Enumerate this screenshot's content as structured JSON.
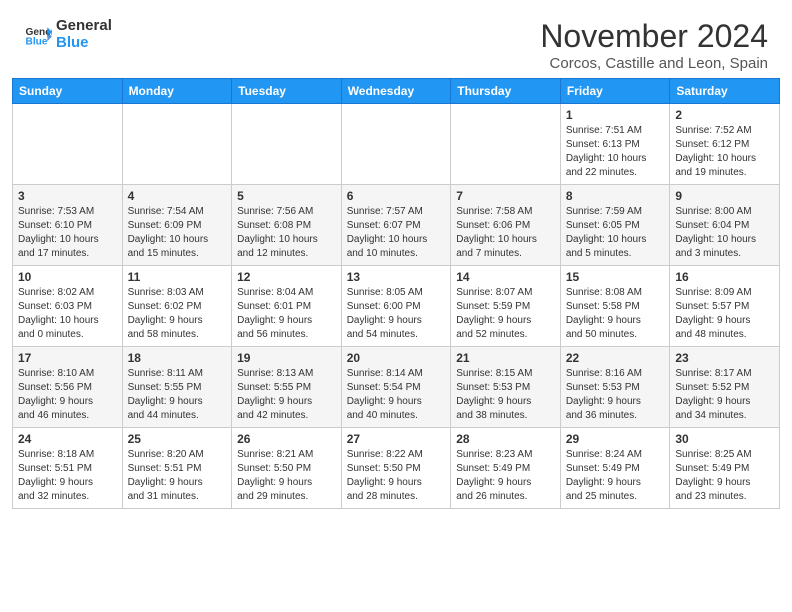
{
  "header": {
    "logo_line1": "General",
    "logo_line2": "Blue",
    "month": "November 2024",
    "location": "Corcos, Castille and Leon, Spain"
  },
  "weekdays": [
    "Sunday",
    "Monday",
    "Tuesday",
    "Wednesday",
    "Thursday",
    "Friday",
    "Saturday"
  ],
  "weeks": [
    [
      {
        "day": "",
        "info": ""
      },
      {
        "day": "",
        "info": ""
      },
      {
        "day": "",
        "info": ""
      },
      {
        "day": "",
        "info": ""
      },
      {
        "day": "",
        "info": ""
      },
      {
        "day": "1",
        "info": "Sunrise: 7:51 AM\nSunset: 6:13 PM\nDaylight: 10 hours\nand 22 minutes."
      },
      {
        "day": "2",
        "info": "Sunrise: 7:52 AM\nSunset: 6:12 PM\nDaylight: 10 hours\nand 19 minutes."
      }
    ],
    [
      {
        "day": "3",
        "info": "Sunrise: 7:53 AM\nSunset: 6:10 PM\nDaylight: 10 hours\nand 17 minutes."
      },
      {
        "day": "4",
        "info": "Sunrise: 7:54 AM\nSunset: 6:09 PM\nDaylight: 10 hours\nand 15 minutes."
      },
      {
        "day": "5",
        "info": "Sunrise: 7:56 AM\nSunset: 6:08 PM\nDaylight: 10 hours\nand 12 minutes."
      },
      {
        "day": "6",
        "info": "Sunrise: 7:57 AM\nSunset: 6:07 PM\nDaylight: 10 hours\nand 10 minutes."
      },
      {
        "day": "7",
        "info": "Sunrise: 7:58 AM\nSunset: 6:06 PM\nDaylight: 10 hours\nand 7 minutes."
      },
      {
        "day": "8",
        "info": "Sunrise: 7:59 AM\nSunset: 6:05 PM\nDaylight: 10 hours\nand 5 minutes."
      },
      {
        "day": "9",
        "info": "Sunrise: 8:00 AM\nSunset: 6:04 PM\nDaylight: 10 hours\nand 3 minutes."
      }
    ],
    [
      {
        "day": "10",
        "info": "Sunrise: 8:02 AM\nSunset: 6:03 PM\nDaylight: 10 hours\nand 0 minutes."
      },
      {
        "day": "11",
        "info": "Sunrise: 8:03 AM\nSunset: 6:02 PM\nDaylight: 9 hours\nand 58 minutes."
      },
      {
        "day": "12",
        "info": "Sunrise: 8:04 AM\nSunset: 6:01 PM\nDaylight: 9 hours\nand 56 minutes."
      },
      {
        "day": "13",
        "info": "Sunrise: 8:05 AM\nSunset: 6:00 PM\nDaylight: 9 hours\nand 54 minutes."
      },
      {
        "day": "14",
        "info": "Sunrise: 8:07 AM\nSunset: 5:59 PM\nDaylight: 9 hours\nand 52 minutes."
      },
      {
        "day": "15",
        "info": "Sunrise: 8:08 AM\nSunset: 5:58 PM\nDaylight: 9 hours\nand 50 minutes."
      },
      {
        "day": "16",
        "info": "Sunrise: 8:09 AM\nSunset: 5:57 PM\nDaylight: 9 hours\nand 48 minutes."
      }
    ],
    [
      {
        "day": "17",
        "info": "Sunrise: 8:10 AM\nSunset: 5:56 PM\nDaylight: 9 hours\nand 46 minutes."
      },
      {
        "day": "18",
        "info": "Sunrise: 8:11 AM\nSunset: 5:55 PM\nDaylight: 9 hours\nand 44 minutes."
      },
      {
        "day": "19",
        "info": "Sunrise: 8:13 AM\nSunset: 5:55 PM\nDaylight: 9 hours\nand 42 minutes."
      },
      {
        "day": "20",
        "info": "Sunrise: 8:14 AM\nSunset: 5:54 PM\nDaylight: 9 hours\nand 40 minutes."
      },
      {
        "day": "21",
        "info": "Sunrise: 8:15 AM\nSunset: 5:53 PM\nDaylight: 9 hours\nand 38 minutes."
      },
      {
        "day": "22",
        "info": "Sunrise: 8:16 AM\nSunset: 5:53 PM\nDaylight: 9 hours\nand 36 minutes."
      },
      {
        "day": "23",
        "info": "Sunrise: 8:17 AM\nSunset: 5:52 PM\nDaylight: 9 hours\nand 34 minutes."
      }
    ],
    [
      {
        "day": "24",
        "info": "Sunrise: 8:18 AM\nSunset: 5:51 PM\nDaylight: 9 hours\nand 32 minutes."
      },
      {
        "day": "25",
        "info": "Sunrise: 8:20 AM\nSunset: 5:51 PM\nDaylight: 9 hours\nand 31 minutes."
      },
      {
        "day": "26",
        "info": "Sunrise: 8:21 AM\nSunset: 5:50 PM\nDaylight: 9 hours\nand 29 minutes."
      },
      {
        "day": "27",
        "info": "Sunrise: 8:22 AM\nSunset: 5:50 PM\nDaylight: 9 hours\nand 28 minutes."
      },
      {
        "day": "28",
        "info": "Sunrise: 8:23 AM\nSunset: 5:49 PM\nDaylight: 9 hours\nand 26 minutes."
      },
      {
        "day": "29",
        "info": "Sunrise: 8:24 AM\nSunset: 5:49 PM\nDaylight: 9 hours\nand 25 minutes."
      },
      {
        "day": "30",
        "info": "Sunrise: 8:25 AM\nSunset: 5:49 PM\nDaylight: 9 hours\nand 23 minutes."
      }
    ]
  ]
}
